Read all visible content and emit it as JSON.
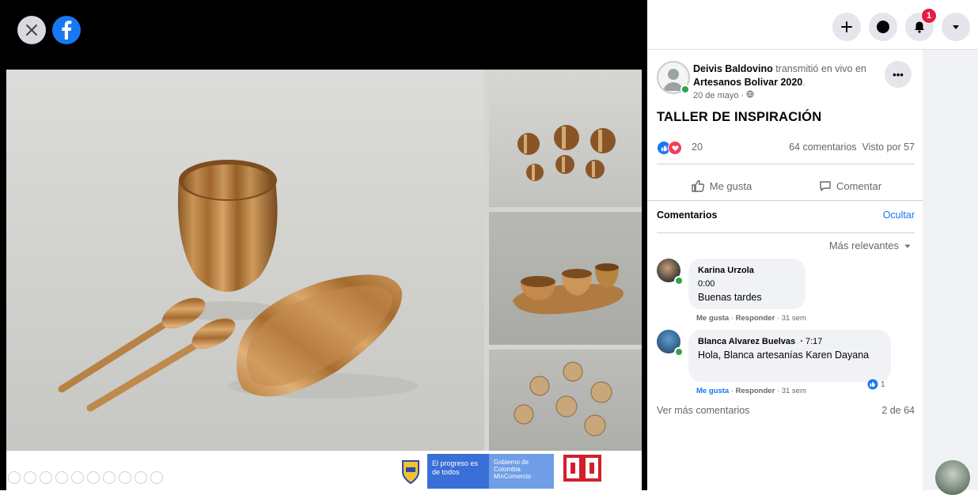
{
  "viewer": {
    "gov_text_1": "El progreso es de todos",
    "gov_text_2": "Gobierno de Colombia MinComercio",
    "red_logo_caption": "Artesanías de Colombia"
  },
  "nav": {
    "notification_count": "1"
  },
  "post": {
    "author": "Deivis Baldovino",
    "action_text": " transmitió en vivo en ",
    "group": "Artesanos Bolivar 2020",
    "date": "20 de mayo · ",
    "title": "TALLER DE INSPIRACIÓN",
    "reactions_count": "20",
    "comments_count": "64 comentarios",
    "views": "Visto por 57",
    "like_label": "Me gusta",
    "comment_label": "Comentar"
  },
  "comments_section": {
    "heading": "Comentarios",
    "hide_label": "Ocultar",
    "sort_label": "Más relevantes",
    "items": [
      {
        "name": "Karina Urzola",
        "timestamp": "0:00",
        "text": "Buenas tardes",
        "like": "Me gusta",
        "reply": "Responder",
        "age": "31 sem"
      },
      {
        "name": "Blanca Alvarez Buelvas",
        "timestamp": "7:17",
        "text": "Hola, Blanca artesanías Karen Dayana",
        "like": "Me gusta",
        "reply": "Responder",
        "age": "31 sem",
        "reactions": "1"
      }
    ],
    "more_label": "Ver más comentarios",
    "page_count": "2 de 64"
  },
  "colors": {
    "facebook_blue": "#1877f2",
    "notification_red": "#e41e3f",
    "online_green": "#31a24c"
  }
}
